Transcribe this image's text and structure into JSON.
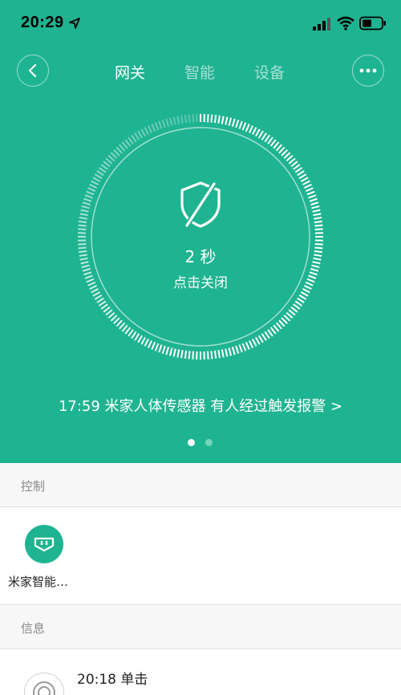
{
  "status_bar": {
    "time": "20:29"
  },
  "nav": {
    "tabs": [
      {
        "label": "网关",
        "active": true
      },
      {
        "label": "智能",
        "active": false
      },
      {
        "label": "设备",
        "active": false
      }
    ]
  },
  "dial": {
    "countdown": "2 秒",
    "hint": "点击关闭",
    "icon": "shield-off-icon"
  },
  "alert": {
    "text": "17:59 米家人体传感器 有人经过触发报警 >"
  },
  "pager": {
    "count": 2,
    "active_index": 0
  },
  "control_section": {
    "title": "控制",
    "devices": [
      {
        "label": "米家智能…",
        "icon": "gateway-plug-icon"
      }
    ]
  },
  "info_section": {
    "title": "信息",
    "rows": [
      {
        "text": "20:18 单击",
        "icon": "switch-button-icon"
      }
    ]
  },
  "colors": {
    "accent": "#1fb491",
    "header_bg": "#f7f7f7"
  }
}
